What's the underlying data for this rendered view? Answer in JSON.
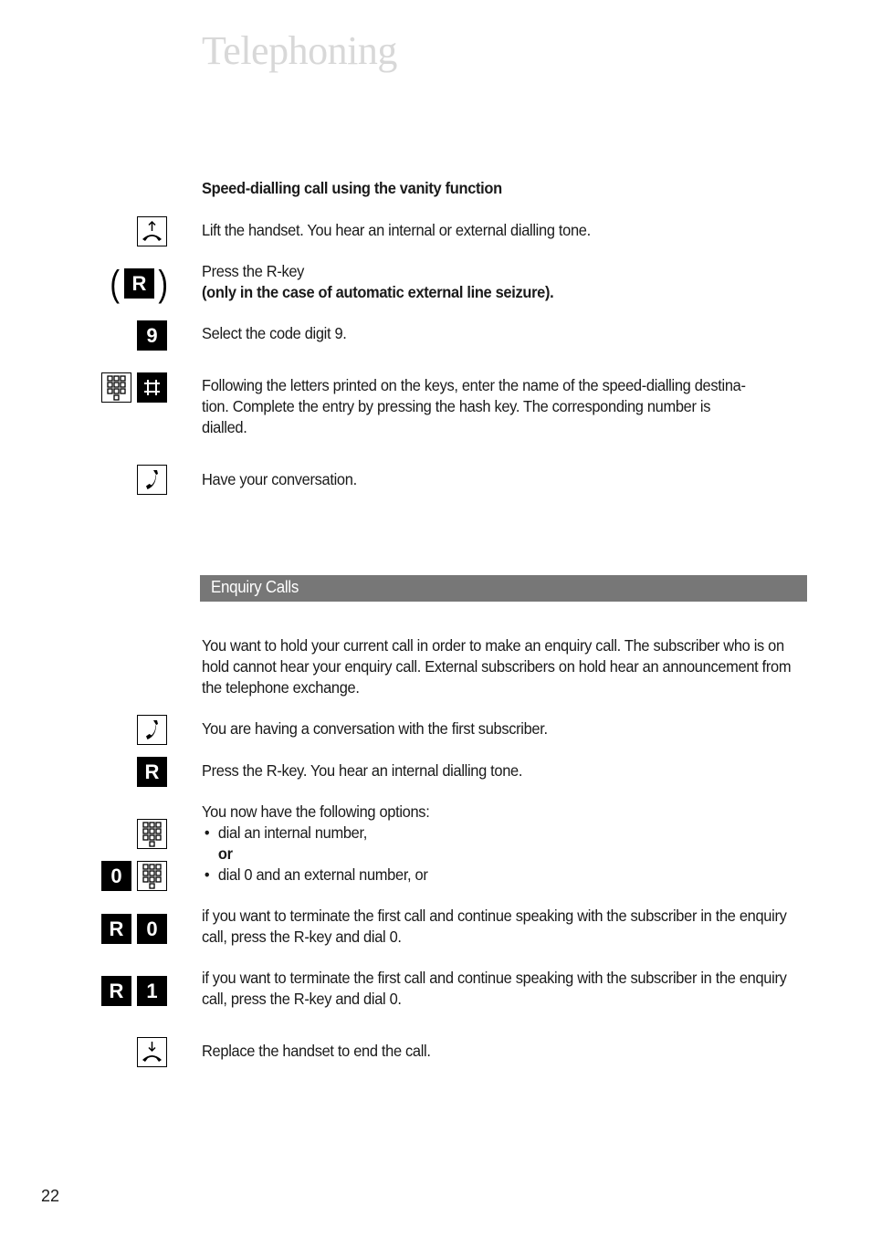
{
  "header": {
    "title": "Telephoning"
  },
  "speed_dialling": {
    "heading": "Speed-dialling call using the vanity function",
    "steps": [
      {
        "icon": "lift-handset-icon",
        "text": "Lift the handset. You hear an internal or external dialling tone."
      },
      {
        "icon": "r-key-optional",
        "key_label": "R",
        "line1": "Press the R-key",
        "line2_bold": "(only in the case of automatic external line seizure)."
      },
      {
        "icon": "digit-key",
        "key_label": "9",
        "text": "Select the code digit 9."
      },
      {
        "icon": "keypad-and-hash",
        "text": "Following the letters printed on the keys, enter the name of the speed-dialling destina-tion. Complete the entry by pressing the hash key. The corresponding number is dialled.",
        "line1": "Following the letters printed on the keys, enter the name of the speed-dialling destina-",
        "line2": "tion. Complete the entry by pressing the hash key. The corresponding number is",
        "line3": "dialled."
      },
      {
        "icon": "conversation-handset-icon",
        "text": "Have your conversation."
      }
    ]
  },
  "enquiry_calls": {
    "section_title": "Enquiry Calls",
    "intro": "You want to hold your current call in order to make an enquiry call. The subscriber who is on hold cannot hear your enquiry call. External subscribers on hold hear an announcement from the telephone exchange.",
    "steps": [
      {
        "icon": "conversation-handset-icon",
        "text": "You are having a conversation with the first subscriber."
      },
      {
        "icon": "r-key",
        "key_label": "R",
        "text": "Press the R-key. You hear an internal dialling tone."
      }
    ],
    "options": {
      "lead": "You now have the following options:",
      "bullet1": "dial an internal number,",
      "or_label": "or",
      "bullet2": "dial 0 and an external number, or",
      "bullet_char": "•",
      "key_zero": "0"
    },
    "terminate_steps": [
      {
        "keys": [
          "R",
          "0"
        ],
        "text": "if you want to terminate the first call and continue speaking with the subscriber in the enquiry call, press the R-key and dial 0."
      },
      {
        "keys": [
          "R",
          "1"
        ],
        "text": "if you want to terminate the first call and continue speaking with the subscriber in the enquiry call, press the R-key and dial 0."
      }
    ],
    "end_step": {
      "icon": "replace-handset-icon",
      "text": "Replace the handset to end the call."
    }
  },
  "parens": {
    "open": "(",
    "close": ")"
  },
  "footer": {
    "page_number": "22"
  },
  "colors": {
    "title": "#d8d8d8",
    "section_bar": "#777777",
    "key_bg": "#000000"
  }
}
